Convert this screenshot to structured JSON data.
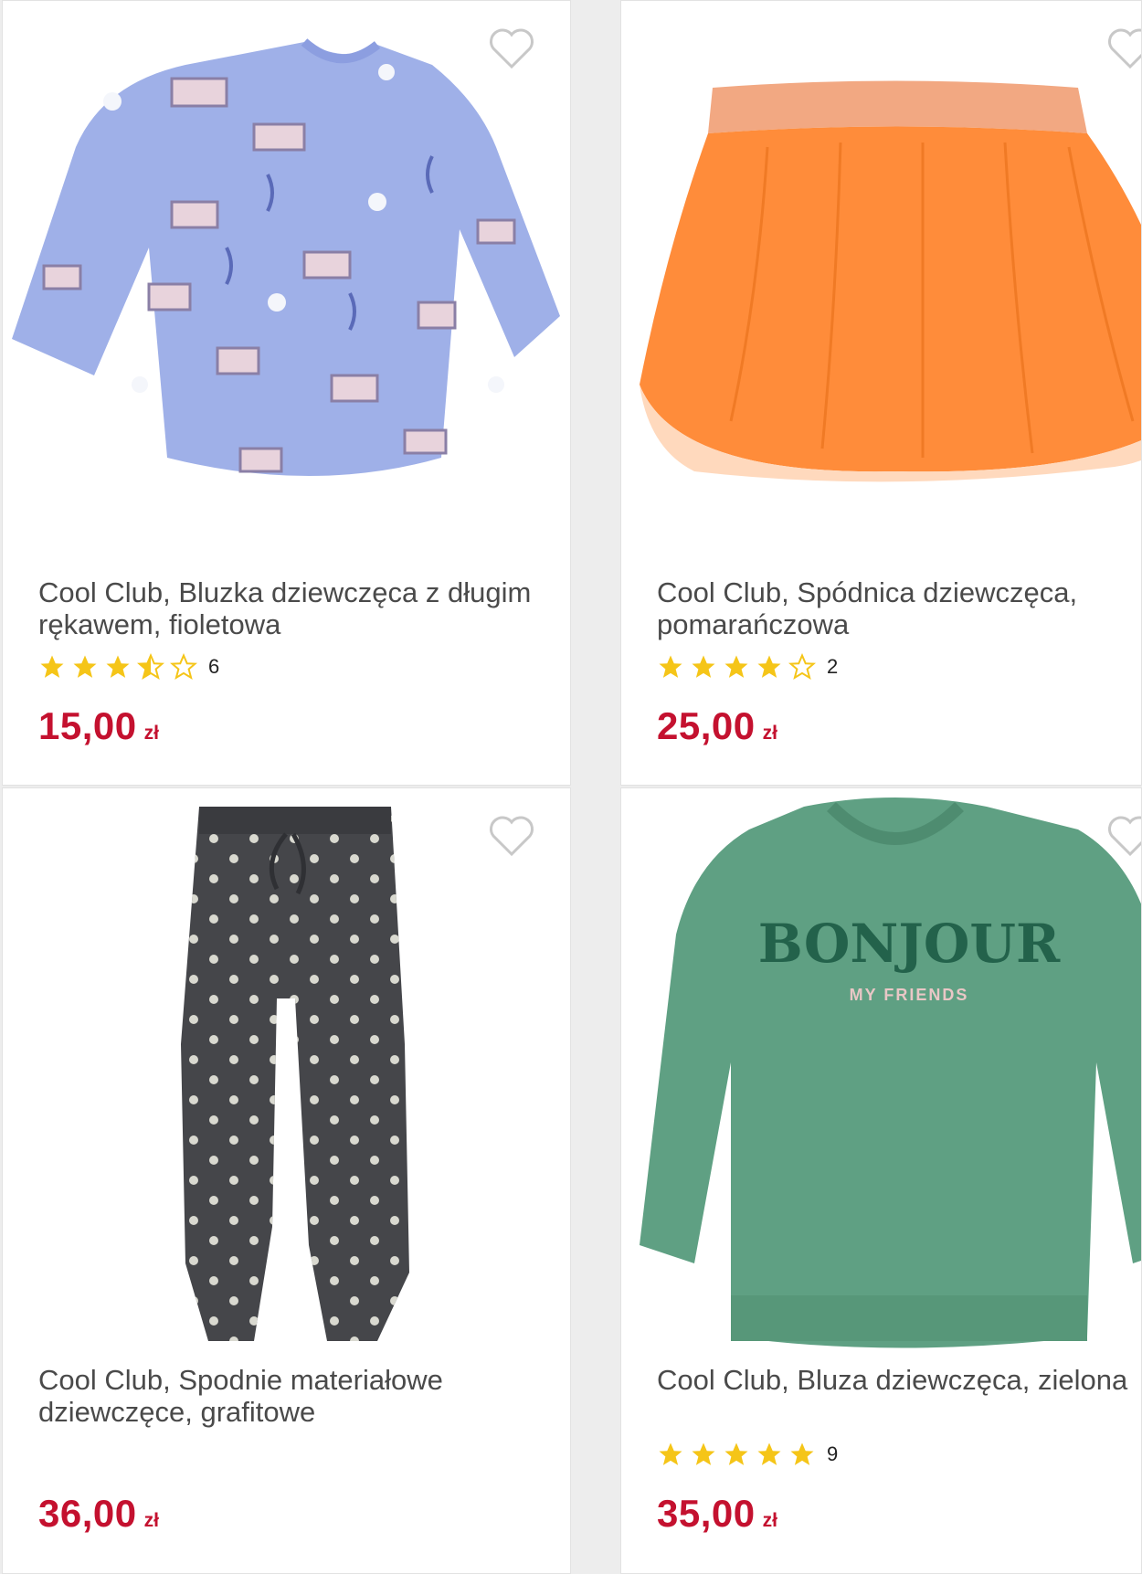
{
  "products": [
    {
      "title": "Cool Club, Bluzka dziewczęca z długim rękawem, fioletowa",
      "rating": 3.5,
      "review_count": "6",
      "price": "15,00",
      "currency": "zł",
      "image_icon": "blouse-image"
    },
    {
      "title": "Cool Club, Spódnica dziewczęca, pomarańczowa",
      "rating": 4,
      "review_count": "2",
      "price": "25,00",
      "currency": "zł",
      "image_icon": "skirt-image"
    },
    {
      "title": "Cool Club, Spodnie materiałowe dziewczęce, grafitowe",
      "price": "36,00",
      "currency": "zł",
      "image_icon": "trousers-image"
    },
    {
      "title": "Cool Club, Bluza dziewczęca, zielona",
      "rating": 5,
      "review_count": "9",
      "price": "35,00",
      "currency": "zł",
      "image_icon": "sweatshirt-image",
      "print_line1": "BONJOUR",
      "print_line2": "MY FRIENDS"
    }
  ],
  "colors": {
    "price": "#c4112f",
    "star": "#f5c518",
    "heart": "#c8c8c8"
  }
}
